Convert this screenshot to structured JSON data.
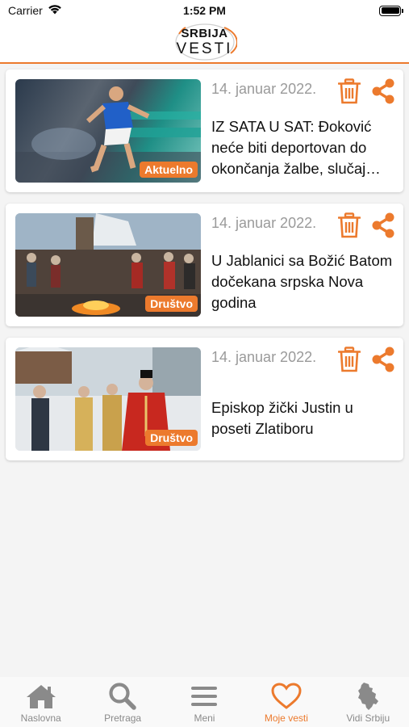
{
  "status_bar": {
    "carrier": "Carrier",
    "time": "1:52 PM"
  },
  "header": {
    "logo_top": "SRBIJA",
    "logo_bottom": "VESTI"
  },
  "colors": {
    "accent": "#ec7a2d",
    "date_gray": "#9a9a9a",
    "tab_gray": "#8a8a8a"
  },
  "articles": [
    {
      "date": "14. januar 2022.",
      "title": "IZ SATA U SAT: Đoković neće biti deportovan do okončanja žalbe, slučaj…",
      "category": "Aktuelno",
      "thumbnail": "tennis-player-photo"
    },
    {
      "date": "14. januar 2022.",
      "title": "U Jablanici sa Božić Batom dočekana srpska Nova godina",
      "category": "Društvo",
      "thumbnail": "winter-gathering-photo"
    },
    {
      "date": "14. januar 2022.",
      "title": "Episkop žički Justin u poseti Zlatiboru",
      "category": "Društvo",
      "thumbnail": "bishop-visit-photo"
    }
  ],
  "tab_bar": {
    "tabs": [
      {
        "label": "Naslovna",
        "icon": "home-icon"
      },
      {
        "label": "Pretraga",
        "icon": "search-icon"
      },
      {
        "label": "Meni",
        "icon": "menu-icon"
      },
      {
        "label": "Moje vesti",
        "icon": "heart-icon",
        "active": true
      },
      {
        "label": "Vidi Srbiju",
        "icon": "serbia-map-icon"
      }
    ]
  }
}
